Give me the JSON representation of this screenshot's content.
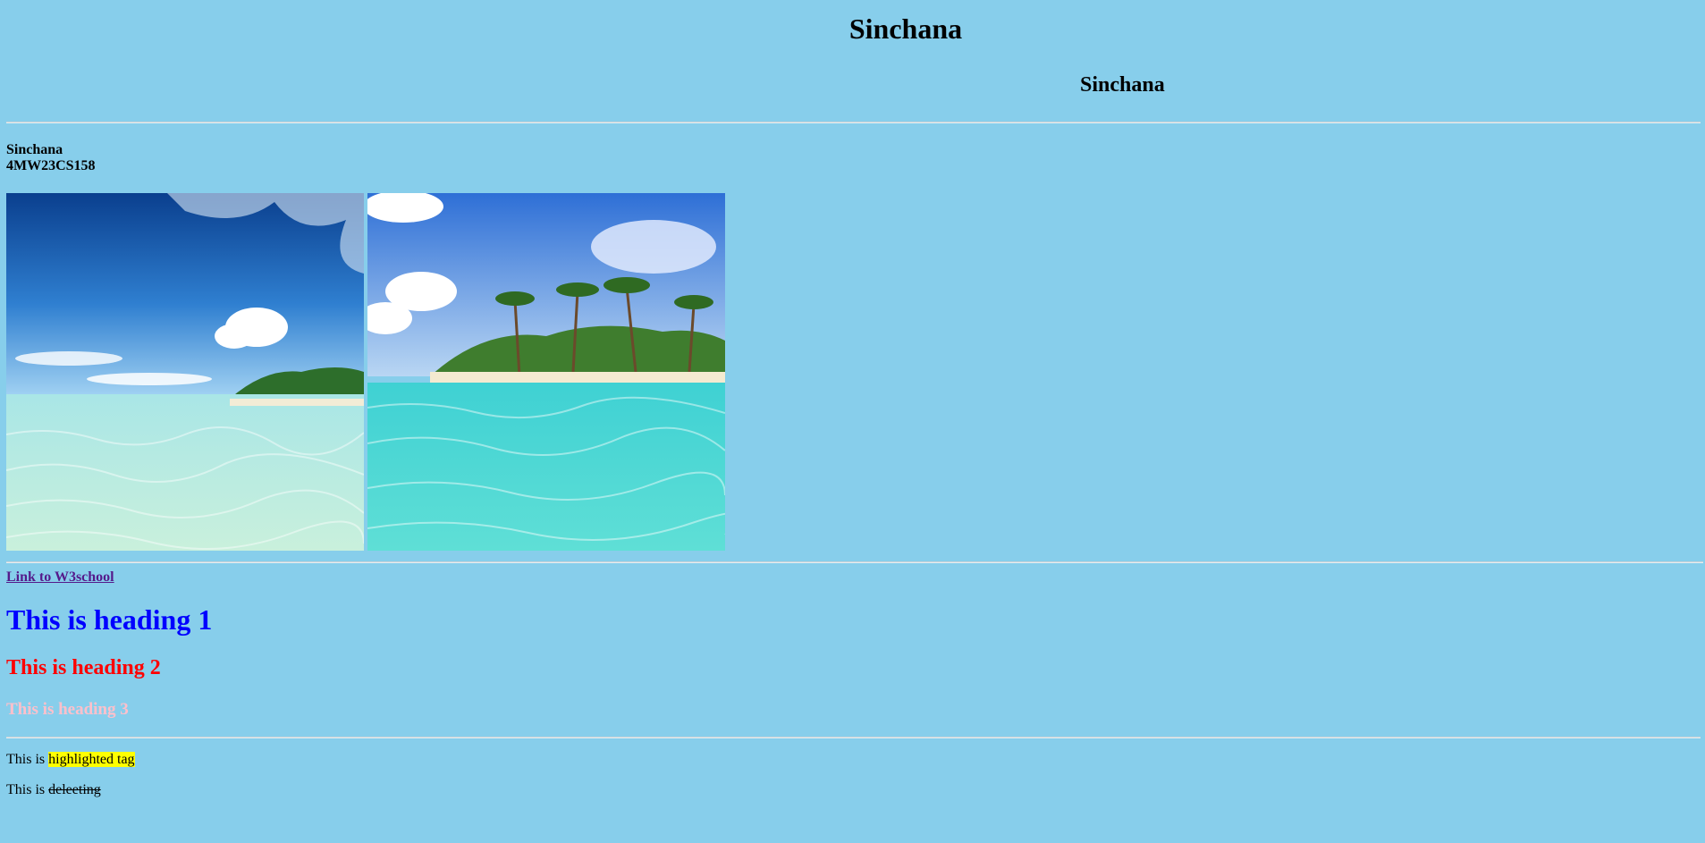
{
  "page": {
    "title_center": "Sinchana",
    "title_right": "Sinchana",
    "name": "Sinchana",
    "usn": "4MW23CS158",
    "link_text": "Link to W3school",
    "heading1": "This is heading 1",
    "heading2": "This is heading 2",
    "heading3": "This is heading 3",
    "line1_prefix": "This is ",
    "line1_highlight": "highlighted tag",
    "line2_prefix": "This is ",
    "line2_deleted": "deleeting"
  },
  "colors": {
    "background": "#87ceeb",
    "heading1": "#0000ff",
    "heading2": "#ff0000",
    "heading3": "#ffc0cb",
    "highlight": "#ffff00",
    "link": "#551a8b"
  },
  "images": [
    {
      "name": "beach-image-1"
    },
    {
      "name": "beach-image-2"
    }
  ]
}
